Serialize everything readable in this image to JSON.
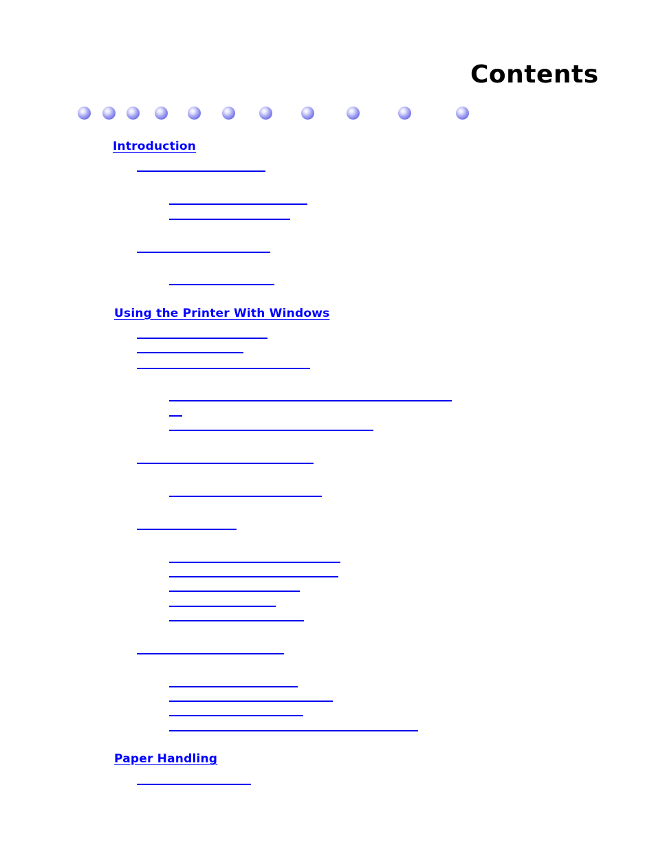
{
  "document": {
    "title": "Contents",
    "link_color": "#0000ff",
    "decoration": {
      "dot_count": 11,
      "dot_color": "#7a7af0"
    },
    "sections": [
      {
        "label": "Introduction",
        "entries": [
          {
            "level": 1,
            "label": ""
          },
          {
            "level": 2,
            "label": ""
          },
          {
            "level": 2,
            "label": ""
          },
          {
            "level": 1,
            "label": ""
          },
          {
            "level": 2,
            "label": ""
          }
        ]
      },
      {
        "label": "Using the Printer With Windows",
        "entries": [
          {
            "level": 1,
            "label": ""
          },
          {
            "level": 1,
            "label": ""
          },
          {
            "level": 1,
            "label": ""
          },
          {
            "level": 2,
            "label": ""
          },
          {
            "level": 2,
            "label": ""
          },
          {
            "level": 2,
            "label": ""
          },
          {
            "level": 1,
            "label": ""
          },
          {
            "level": 2,
            "label": ""
          },
          {
            "level": 1,
            "label": ""
          },
          {
            "level": 2,
            "label": ""
          },
          {
            "level": 2,
            "label": ""
          },
          {
            "level": 2,
            "label": ""
          },
          {
            "level": 2,
            "label": ""
          },
          {
            "level": 2,
            "label": ""
          },
          {
            "level": 1,
            "label": ""
          },
          {
            "level": 2,
            "label": ""
          },
          {
            "level": 2,
            "label": ""
          },
          {
            "level": 2,
            "label": ""
          },
          {
            "level": 2,
            "label": ""
          }
        ]
      },
      {
        "label": "Paper Handling",
        "entries": [
          {
            "level": 1,
            "label": ""
          }
        ]
      }
    ]
  }
}
